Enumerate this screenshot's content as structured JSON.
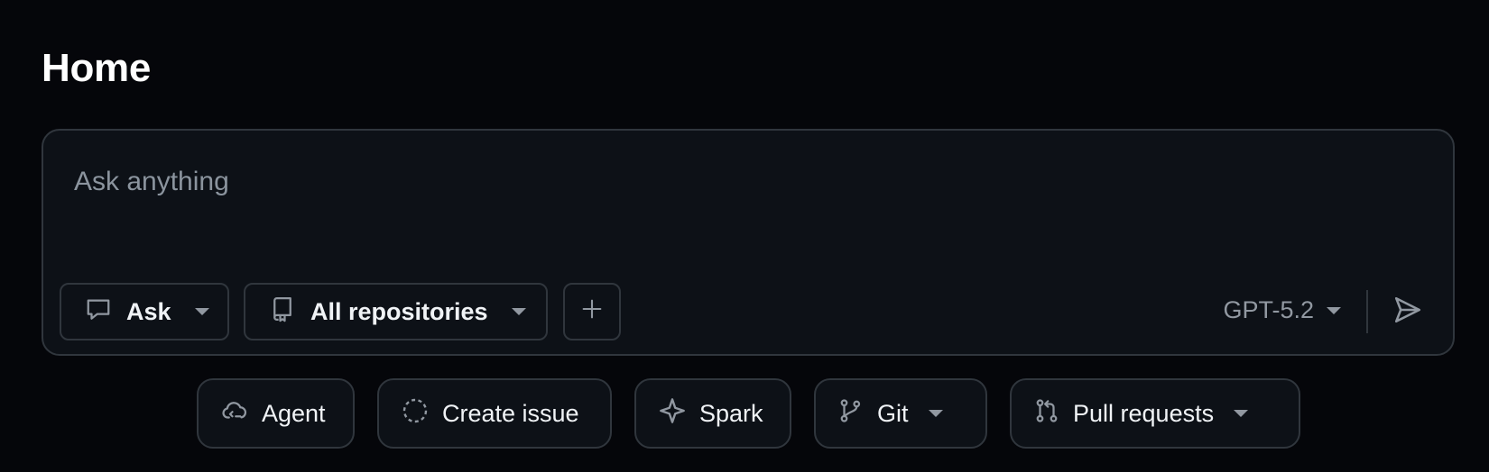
{
  "page": {
    "title": "Home"
  },
  "composer": {
    "placeholder": "Ask anything",
    "mode_label": "Ask",
    "repo_label": "All repositories",
    "model_label": "GPT-5.2"
  },
  "quick_actions": {
    "agent": "Agent",
    "create_issue": "Create issue",
    "spark": "Spark",
    "git": "Git",
    "pull_requests": "Pull requests"
  },
  "icons": {
    "ask": "comment-icon",
    "repo": "repo-icon",
    "plus": "plus-icon",
    "send": "send-icon",
    "agent": "cloud-agent-icon",
    "issue": "issue-draft-icon",
    "spark": "sparkle-icon",
    "git": "git-branch-icon",
    "pr": "pull-request-icon"
  },
  "colors": {
    "background": "#05060a",
    "surface": "#0d1117",
    "border": "#30363d",
    "muted_text": "#8b949e"
  }
}
